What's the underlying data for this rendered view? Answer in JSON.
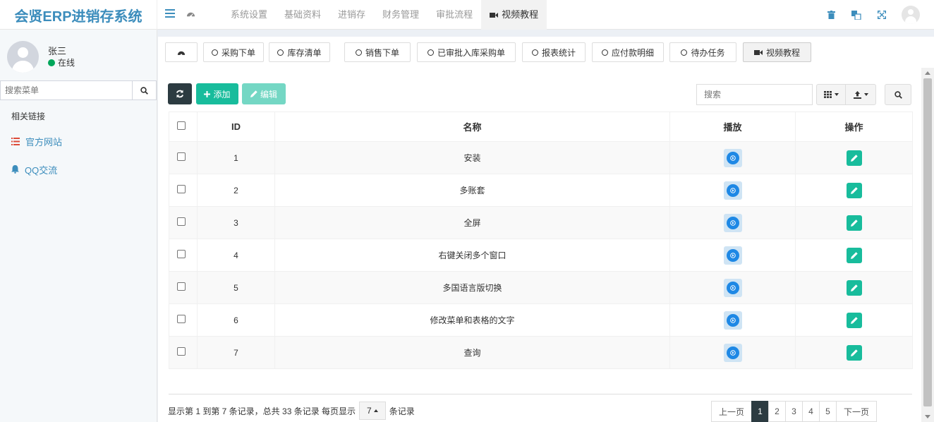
{
  "app": {
    "title": "会贤ERP进销存系统"
  },
  "topnav": {
    "items": [
      "系统设置",
      "基础资料",
      "进销存",
      "财务管理",
      "审批流程",
      "视频教程"
    ],
    "active_index": 5
  },
  "user": {
    "name": "张三",
    "status": "在线",
    "status_color": "#00a65a"
  },
  "sidebar": {
    "search_placeholder": "搜索菜单",
    "header": "相关链接",
    "links": [
      {
        "label": "官方网站",
        "icon": "list-icon",
        "icon_color": "#dd4b39"
      },
      {
        "label": "QQ交流",
        "icon": "bell-icon",
        "icon_color": "#3c8dbc"
      }
    ]
  },
  "tabs": {
    "items": [
      "采购下单",
      "库存清单",
      "销售下单",
      "已审批入库采购单",
      "报表统计",
      "应付款明细",
      "待办任务",
      "视频教程"
    ],
    "active_index": 7
  },
  "toolbar": {
    "add_label": "添加",
    "edit_label": "编辑",
    "search_placeholder": "搜索"
  },
  "table": {
    "columns": [
      "ID",
      "名称",
      "播放",
      "操作"
    ],
    "rows": [
      {
        "id": "1",
        "name": "安装"
      },
      {
        "id": "2",
        "name": "多账套"
      },
      {
        "id": "3",
        "name": "全屏"
      },
      {
        "id": "4",
        "name": "右键关闭多个窗口"
      },
      {
        "id": "5",
        "name": "多国语言版切换"
      },
      {
        "id": "6",
        "name": "修改菜单和表格的文字"
      },
      {
        "id": "7",
        "name": "查询"
      }
    ]
  },
  "pagination": {
    "info": "显示第 1 到第 7 条记录，总共 33 条记录 每页显示",
    "page_size": "7",
    "suffix": "条记录",
    "prev": "上一页",
    "pages": [
      "1",
      "2",
      "3",
      "4",
      "5"
    ],
    "current": "1",
    "next": "下一页"
  },
  "colors": {
    "brand": "#3c8dbc",
    "add": "#18bc9c",
    "edit": "#74d7c4",
    "dark": "#2c3b41",
    "play": "#1e88e5"
  }
}
